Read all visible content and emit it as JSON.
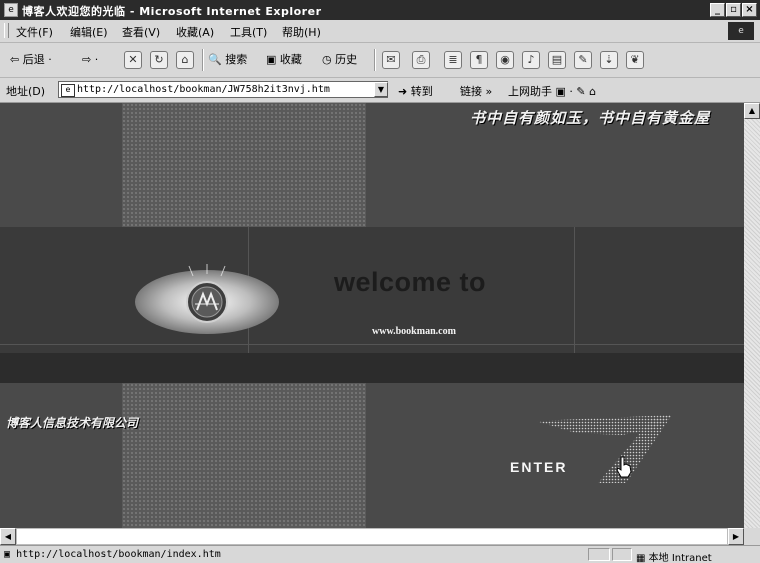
{
  "window": {
    "title": "博客人欢迎您的光临 - Microsoft Internet Explorer",
    "buttons": {
      "minimize": "_",
      "maximize": "▫",
      "close": "×"
    }
  },
  "menubar": {
    "items": [
      "文件(F)",
      "编辑(E)",
      "查看(V)",
      "收藏(A)",
      "工具(T)",
      "帮助(H)"
    ]
  },
  "toolbar": {
    "back": "后退",
    "search": "搜索",
    "favorites": "收藏",
    "history": "历史"
  },
  "addressbar": {
    "label": "地址(D)",
    "url": "http://localhost/bookman/JW758h2it3nvj.htm",
    "go": "转到",
    "links": "链接 »",
    "helper": "上网助手"
  },
  "page": {
    "slogan_top": "书中自有颜如玉，书中自有黄金屋",
    "slogan_left": "博客人信息技术有限公司",
    "welcome": "welcome to",
    "site": "www.bookman.com",
    "enter": "ENTER"
  },
  "statusbar": {
    "text": "http://localhost/bookman/index.htm",
    "zone": "本地 Intranet"
  }
}
